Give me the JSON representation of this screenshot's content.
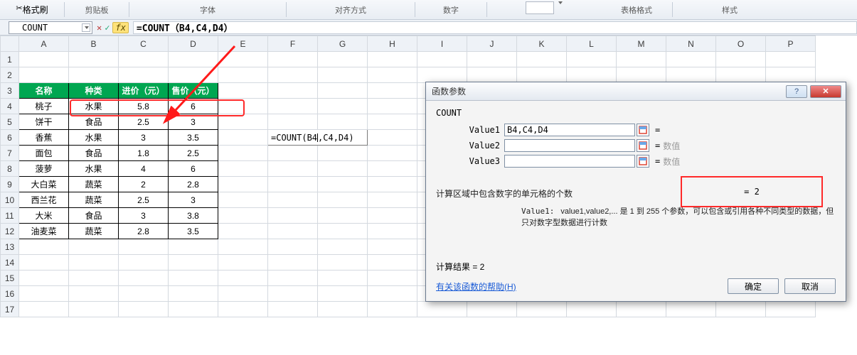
{
  "ribbon": {
    "clipboard": "剪贴板",
    "format_painter": "格式刷",
    "font": "字体",
    "alignment": "对齐方式",
    "number": "数字",
    "table_format": "表格格式",
    "styles": "样式"
  },
  "fx": {
    "namebox": "COUNT",
    "formula": "=COUNT（B4,C4,D4）"
  },
  "columns": [
    "A",
    "B",
    "C",
    "D",
    "E",
    "F",
    "G",
    "H",
    "I",
    "J",
    "K",
    "L",
    "M",
    "N",
    "O",
    "P"
  ],
  "headers": {
    "c1": "名称",
    "c2": "种类",
    "c3": "进价（元）",
    "c4": "售价（元）"
  },
  "rows": [
    {
      "a": "桃子",
      "b": "水果",
      "c": "5.8",
      "d": "6"
    },
    {
      "a": "饼干",
      "b": "食品",
      "c": "2.5",
      "d": "3"
    },
    {
      "a": "香蕉",
      "b": "水果",
      "c": "3",
      "d": "3.5"
    },
    {
      "a": "面包",
      "b": "食品",
      "c": "1.8",
      "d": "2.5"
    },
    {
      "a": "菠萝",
      "b": "水果",
      "c": "4",
      "d": "6"
    },
    {
      "a": "大白菜",
      "b": "蔬菜",
      "c": "2",
      "d": "2.8"
    },
    {
      "a": "西兰花",
      "b": "蔬菜",
      "c": "2.5",
      "d": "3"
    },
    {
      "a": "大米",
      "b": "食品",
      "c": "3",
      "d": "3.8"
    },
    {
      "a": "油麦菜",
      "b": "蔬菜",
      "c": "2.8",
      "d": "3.5"
    }
  ],
  "cell_formula_prefix": "=COUNT(B4",
  "cell_formula_suffix": ",C4,D4)",
  "dialog": {
    "title": "函数参数",
    "func": "COUNT",
    "v1_label": "Value1",
    "v2_label": "Value2",
    "v3_label": "Value3",
    "v1": "B4,C4,D4",
    "eq": "=",
    "ghost": "数值",
    "result_eq": "= 2",
    "desc": "计算区域中包含数字的单元格的个数",
    "param_name": "Value1:",
    "param_text": "value1,value2,... 是 1 到 255 个参数，可以包含或引用各种不同类型的数据，但只对数字型数据进行计数",
    "calc_result": "计算结果 = 2",
    "help": "有关该函数的帮助(H)",
    "ok": "确定",
    "cancel": "取消"
  }
}
